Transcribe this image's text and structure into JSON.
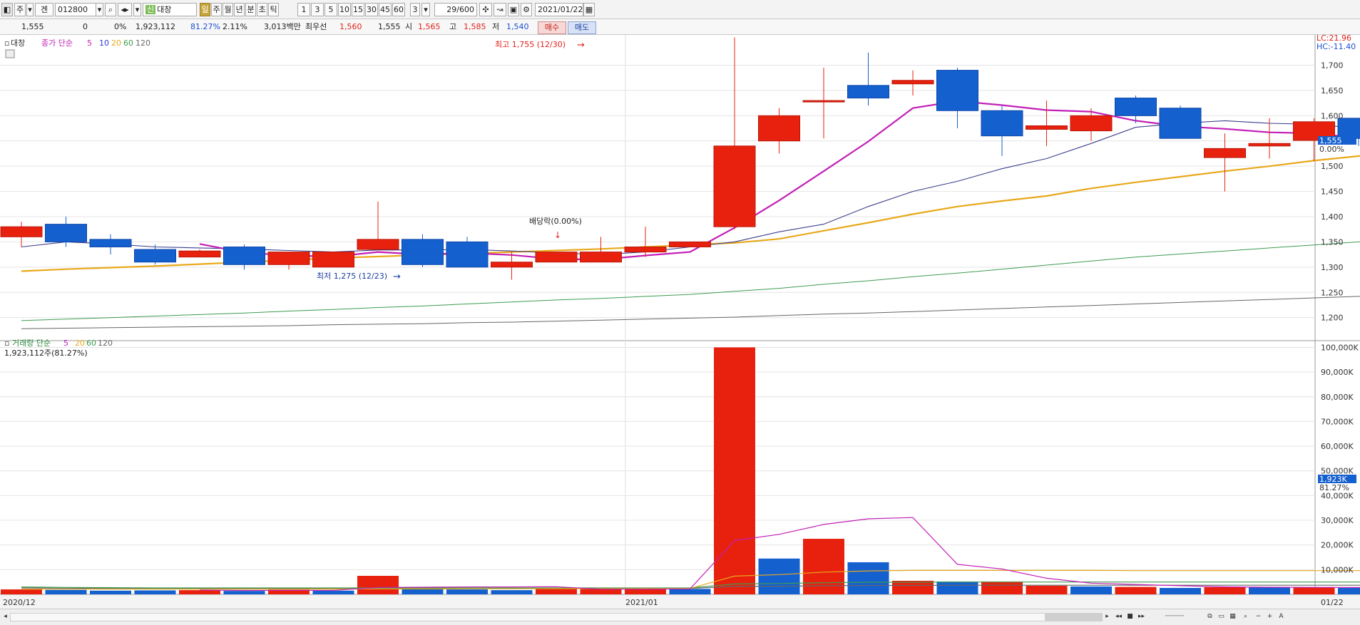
{
  "toolbar": {
    "market": "주",
    "stock_code": "012800",
    "stock_name_badge": "신",
    "stock_name": "대창",
    "periods": [
      "일",
      "주",
      "월",
      "년",
      "분",
      "초",
      "틱"
    ],
    "active_period": "일",
    "intervals": [
      "1",
      "3",
      "5",
      "10",
      "15",
      "30",
      "45",
      "60"
    ],
    "custom_interval": "3",
    "count": "29/600",
    "date": "2021/01/22"
  },
  "quote": {
    "price": "1,555",
    "change": "0",
    "change_pct": "0%",
    "volume": "1,923,112",
    "vol_ratio": "81.27%",
    "turnover": "2.11%",
    "amount": "3,013백만",
    "best_ask_label": "최우선",
    "best_ask": "1,560",
    "best_bid": "1,555",
    "open_label": "시",
    "open": "1,565",
    "high_label": "고",
    "high": "1,585",
    "low_label": "저",
    "low": "1,540",
    "buy_label": "매수",
    "sell_label": "매도"
  },
  "price_legend": {
    "name": "대창",
    "label": "종가 단순",
    "ma": [
      "5",
      "10",
      "20",
      "60",
      "120"
    ]
  },
  "volume_legend": {
    "label": "거래량 단순",
    "ma": [
      "5",
      "20",
      "60",
      "120"
    ],
    "current": "1,923,112주(81.27%)"
  },
  "colors": {
    "up": "#e8210f",
    "down": "#1560cf",
    "ma5": "#c21fb6",
    "ma10": "#3c3f8c",
    "ma20": "#e8a81a",
    "ma60": "#3d9b4f",
    "ma120": "#666666"
  },
  "chart_data": [
    {
      "type": "candlestick",
      "title": "대창",
      "x": [
        "2020-12-07",
        "2020-12-08",
        "2020-12-09",
        "2020-12-10",
        "2020-12-11",
        "2020-12-14",
        "2020-12-15",
        "2020-12-16",
        "2020-12-17",
        "2020-12-18",
        "2020-12-21",
        "2020-12-22",
        "2020-12-23",
        "2020-12-24",
        "2020-12-28",
        "2020-12-29",
        "2020-12-30",
        "2021-01-04",
        "2021-01-05",
        "2021-01-06",
        "2021-01-07",
        "2021-01-08",
        "2021-01-11",
        "2021-01-12",
        "2021-01-13",
        "2021-01-14",
        "2021-01-15",
        "2021-01-18",
        "2021-01-19",
        "2021-01-20",
        "2021-01-21",
        "2021-01-22"
      ],
      "open": [
        1360,
        1385,
        1355,
        1335,
        1320,
        1340,
        1305,
        1300,
        1335,
        1355,
        1350,
        1300,
        1310,
        1310,
        1330,
        1340,
        1380,
        1550,
        1630,
        1660,
        1663,
        1690,
        1610,
        1573,
        1570,
        1635,
        1615,
        1517,
        1540,
        1551,
        1595,
        1565
      ],
      "high": [
        1390,
        1400,
        1365,
        1345,
        1335,
        1345,
        1330,
        1330,
        1430,
        1365,
        1360,
        1330,
        1330,
        1360,
        1380,
        1350,
        1755,
        1615,
        1695,
        1725,
        1690,
        1695,
        1620,
        1630,
        1615,
        1640,
        1620,
        1565,
        1595,
        1595,
        1595,
        1585
      ],
      "low": [
        1340,
        1340,
        1325,
        1305,
        1320,
        1295,
        1295,
        1300,
        1335,
        1300,
        1310,
        1275,
        1310,
        1310,
        1320,
        1340,
        1375,
        1525,
        1555,
        1620,
        1640,
        1575,
        1520,
        1540,
        1550,
        1585,
        1555,
        1450,
        1515,
        1510,
        1540,
        1540
      ],
      "close": [
        1380,
        1350,
        1340,
        1310,
        1332,
        1305,
        1330,
        1330,
        1355,
        1305,
        1300,
        1310,
        1330,
        1330,
        1340,
        1350,
        1540,
        1600,
        1630,
        1635,
        1670,
        1610,
        1560,
        1580,
        1600,
        1600,
        1555,
        1535,
        1545,
        1588,
        1555,
        1555
      ],
      "ma5": [
        null,
        null,
        null,
        null,
        1346,
        1329,
        1323,
        1321,
        1330,
        1325,
        1328,
        1324,
        1316,
        1315,
        1323,
        1330,
        1378,
        1432,
        1490,
        1549,
        1615,
        1629,
        1621,
        1611,
        1608,
        1590,
        1579,
        1574,
        1567,
        1565,
        1556,
        1548
      ],
      "ma10": [
        1340,
        1350,
        1346,
        1340,
        1338,
        1336,
        1333,
        1330,
        1334,
        1334,
        1335,
        1332,
        1328,
        1325,
        1330,
        1340,
        1350,
        1370,
        1385,
        1420,
        1450,
        1470,
        1495,
        1515,
        1545,
        1577,
        1585,
        1590,
        1585,
        1583,
        1575,
        1567
      ],
      "ma20": [
        1292,
        1296,
        1299,
        1302,
        1306,
        1310,
        1314,
        1318,
        1321,
        1324,
        1327,
        1330,
        1333,
        1336,
        1340,
        1344,
        1348,
        1356,
        1372,
        1388,
        1405,
        1420,
        1431,
        1441,
        1456,
        1468,
        1479,
        1490,
        1500,
        1511,
        1520,
        1530
      ],
      "ma60": [
        1194,
        1197,
        1200,
        1203,
        1206,
        1209,
        1213,
        1216,
        1220,
        1223,
        1227,
        1231,
        1235,
        1238,
        1242,
        1246,
        1252,
        1258,
        1266,
        1273,
        1281,
        1288,
        1296,
        1304,
        1312,
        1320,
        1326,
        1332,
        1338,
        1344,
        1350,
        1357
      ],
      "ma120": [
        1178,
        1179,
        1180,
        1181,
        1182,
        1183,
        1184,
        1186,
        1187,
        1188,
        1190,
        1191,
        1193,
        1195,
        1197,
        1199,
        1201,
        1204,
        1207,
        1209,
        1212,
        1215,
        1218,
        1221,
        1224,
        1227,
        1230,
        1233,
        1236,
        1239,
        1242,
        1246
      ],
      "ylim": [
        1160,
        1760
      ],
      "yticks": [
        "1,200",
        "1,250",
        "1,300",
        "1,350",
        "1,400",
        "1,450",
        "1,500",
        "1,550",
        "1,600",
        "1,650",
        "1,700"
      ],
      "xlabels": [
        "2020/12",
        "2021/01",
        "01/22"
      ],
      "annotations": [
        "최고 1,755 (12/30)",
        "최저 1,275 (12/23)",
        "배당락(0.00%)"
      ],
      "side_labels": {
        "lc": "LC:21.96",
        "hc": "HC:-11.40",
        "current": "1,555",
        "current_pct": "0.00%"
      }
    },
    {
      "type": "bar",
      "title": "거래량",
      "x": [
        "2020-12-07",
        "2020-12-08",
        "2020-12-09",
        "2020-12-10",
        "2020-12-11",
        "2020-12-14",
        "2020-12-15",
        "2020-12-16",
        "2020-12-17",
        "2020-12-18",
        "2020-12-21",
        "2020-12-22",
        "2020-12-23",
        "2020-12-24",
        "2020-12-28",
        "2020-12-29",
        "2020-12-30",
        "2021-01-04",
        "2021-01-05",
        "2021-01-06",
        "2021-01-07",
        "2021-01-08",
        "2021-01-11",
        "2021-01-12",
        "2021-01-13",
        "2021-01-14",
        "2021-01-15",
        "2021-01-18",
        "2021-01-19",
        "2021-01-20",
        "2021-01-21",
        "2021-01-22"
      ],
      "values": [
        2000,
        1800,
        1500,
        1600,
        1700,
        1400,
        1900,
        1500,
        7500,
        2200,
        2000,
        1700,
        2200,
        2500,
        2100,
        2200,
        100000,
        14500,
        22500,
        13000,
        5500,
        5200,
        5200,
        3500,
        3200,
        3000,
        2600,
        2900,
        2800,
        2900,
        2600,
        1923
      ],
      "up": [
        true,
        false,
        false,
        false,
        true,
        false,
        true,
        false,
        true,
        false,
        false,
        false,
        true,
        true,
        true,
        false,
        true,
        false,
        true,
        false,
        true,
        false,
        true,
        true,
        false,
        true,
        false,
        true,
        false,
        true,
        false,
        false
      ],
      "ma5": [
        null,
        null,
        null,
        null,
        1720,
        1600,
        1620,
        1620,
        2800,
        2900,
        3000,
        3000,
        3100,
        2100,
        2100,
        2200,
        21800,
        24300,
        28300,
        30600,
        31100,
        12140,
        10280,
        6520,
        4520,
        4020,
        3500,
        3040,
        2900,
        2840,
        2760,
        2610
      ],
      "ma20": [
        2100,
        2100,
        2100,
        2100,
        2100,
        2100,
        2100,
        2150,
        2200,
        2200,
        2250,
        2250,
        2300,
        2300,
        2350,
        2400,
        7400,
        8000,
        9000,
        9500,
        9700,
        9700,
        9700,
        9700,
        9700,
        9600,
        9600,
        9600,
        9600,
        9600,
        9600,
        9600
      ],
      "ma60": [
        3000,
        2800,
        2700,
        2600,
        2600,
        2600,
        2600,
        2600,
        2600,
        2600,
        2600,
        2600,
        2600,
        2600,
        2600,
        2600,
        4200,
        4400,
        4700,
        4900,
        4900,
        5000,
        5000,
        5000,
        5000,
        5000,
        5000,
        5000,
        5000,
        5000,
        5000,
        5000
      ],
      "ma120": [
        2600,
        2500,
        2400,
        2400,
        2400,
        2400,
        2400,
        2400,
        2400,
        2400,
        2400,
        2400,
        2400,
        2400,
        2400,
        2400,
        3200,
        3300,
        3500,
        3600,
        3600,
        3700,
        3700,
        3700,
        3700,
        3700,
        3700,
        3700,
        3700,
        3700,
        3700,
        3700
      ],
      "ylim": [
        0,
        101000
      ],
      "yticks": [
        "10,000K",
        "20,000K",
        "30,000K",
        "40,000K",
        "50,000K",
        "60,000K",
        "70,000K",
        "80,000K",
        "90,000K",
        "100,000K"
      ],
      "side_labels": {
        "current": "1,923K",
        "pct": "81.27%"
      }
    }
  ]
}
